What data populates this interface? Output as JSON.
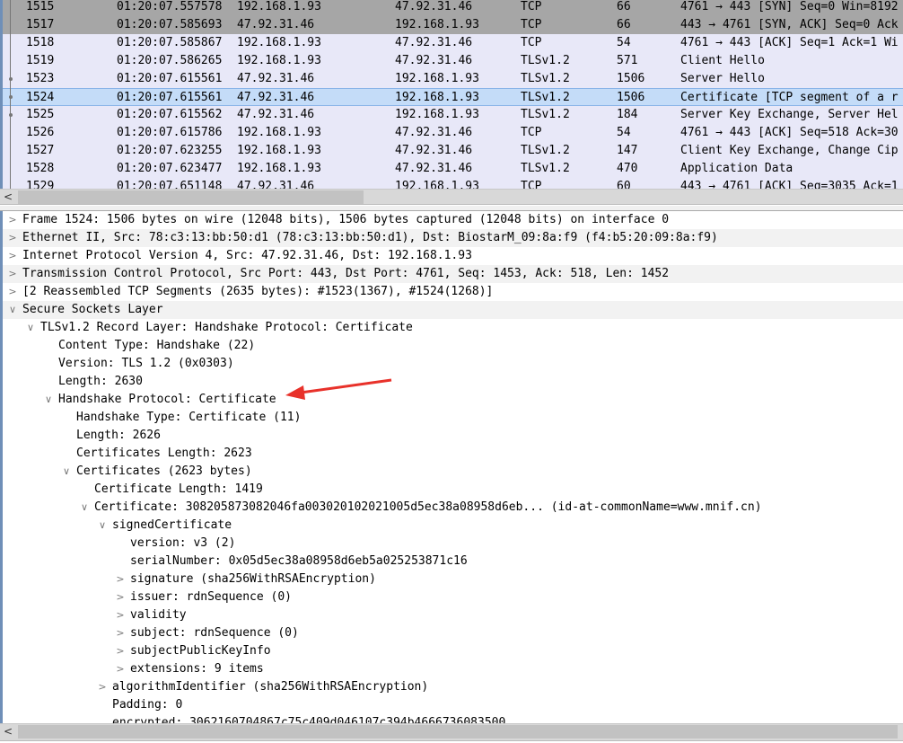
{
  "packet_list": {
    "rows": [
      {
        "no": "1515",
        "time": "01:20:07.557578",
        "src": "192.168.1.93",
        "dst": "47.92.31.46",
        "proto": "TCP",
        "len": "66",
        "info": "4761 → 443 [SYN] Seq=0 Win=8192",
        "style": "gray"
      },
      {
        "no": "1517",
        "time": "01:20:07.585693",
        "src": "47.92.31.46",
        "dst": "192.168.1.93",
        "proto": "TCP",
        "len": "66",
        "info": "443 → 4761 [SYN, ACK] Seq=0 Ack",
        "style": "gray"
      },
      {
        "no": "1518",
        "time": "01:20:07.585867",
        "src": "192.168.1.93",
        "dst": "47.92.31.46",
        "proto": "TCP",
        "len": "54",
        "info": "4761 → 443 [ACK] Seq=1 Ack=1 Wi",
        "style": ""
      },
      {
        "no": "1519",
        "time": "01:20:07.586265",
        "src": "192.168.1.93",
        "dst": "47.92.31.46",
        "proto": "TLSv1.2",
        "len": "571",
        "info": "Client Hello",
        "style": ""
      },
      {
        "no": "1523",
        "time": "01:20:07.615561",
        "src": "47.92.31.46",
        "dst": "192.168.1.93",
        "proto": "TLSv1.2",
        "len": "1506",
        "info": "Server Hello",
        "style": ""
      },
      {
        "no": "1524",
        "time": "01:20:07.615561",
        "src": "47.92.31.46",
        "dst": "192.168.1.93",
        "proto": "TLSv1.2",
        "len": "1506",
        "info": "Certificate [TCP segment of a r",
        "style": "sel"
      },
      {
        "no": "1525",
        "time": "01:20:07.615562",
        "src": "47.92.31.46",
        "dst": "192.168.1.93",
        "proto": "TLSv1.2",
        "len": "184",
        "info": "Server Key Exchange, Server Hel",
        "style": ""
      },
      {
        "no": "1526",
        "time": "01:20:07.615786",
        "src": "192.168.1.93",
        "dst": "47.92.31.46",
        "proto": "TCP",
        "len": "54",
        "info": "4761 → 443 [ACK] Seq=518 Ack=30",
        "style": ""
      },
      {
        "no": "1527",
        "time": "01:20:07.623255",
        "src": "192.168.1.93",
        "dst": "47.92.31.46",
        "proto": "TLSv1.2",
        "len": "147",
        "info": "Client Key Exchange, Change Cip",
        "style": ""
      },
      {
        "no": "1528",
        "time": "01:20:07.623477",
        "src": "192.168.1.93",
        "dst": "47.92.31.46",
        "proto": "TLSv1.2",
        "len": "470",
        "info": "Application Data",
        "style": ""
      },
      {
        "no": "1529",
        "time": "01:20:07.651148",
        "src": "47.92.31.46",
        "dst": "192.168.1.93",
        "proto": "TCP",
        "len": "60",
        "info": "443 → 4761 [ACK] Seq=3035 Ack=1",
        "style": ""
      }
    ],
    "scroll_left_glyph": "<"
  },
  "details": {
    "rows": [
      {
        "level": 0,
        "state": "collapsed",
        "text": "Frame 1524: 1506 bytes on wire (12048 bits), 1506 bytes captured (12048 bits) on interface 0"
      },
      {
        "level": 0,
        "state": "collapsed",
        "text": "Ethernet II, Src: 78:c3:13:bb:50:d1 (78:c3:13:bb:50:d1), Dst: BiostarM_09:8a:f9 (f4:b5:20:09:8a:f9)"
      },
      {
        "level": 0,
        "state": "collapsed",
        "text": "Internet Protocol Version 4, Src: 47.92.31.46, Dst: 192.168.1.93"
      },
      {
        "level": 0,
        "state": "collapsed",
        "text": "Transmission Control Protocol, Src Port: 443, Dst Port: 4761, Seq: 1453, Ack: 518, Len: 1452"
      },
      {
        "level": 0,
        "state": "collapsed",
        "text": "[2 Reassembled TCP Segments (2635 bytes): #1523(1367), #1524(1268)]"
      },
      {
        "level": 0,
        "state": "expanded",
        "text": "Secure Sockets Layer"
      },
      {
        "level": 1,
        "state": "expanded",
        "text": "TLSv1.2 Record Layer: Handshake Protocol: Certificate"
      },
      {
        "level": 2,
        "state": "leaf",
        "text": "Content Type: Handshake (22)"
      },
      {
        "level": 2,
        "state": "leaf",
        "text": "Version: TLS 1.2 (0x0303)"
      },
      {
        "level": 2,
        "state": "leaf",
        "text": "Length: 2630"
      },
      {
        "level": 2,
        "state": "expanded",
        "text": "Handshake Protocol: Certificate"
      },
      {
        "level": 3,
        "state": "leaf",
        "text": "Handshake Type: Certificate (11)"
      },
      {
        "level": 3,
        "state": "leaf",
        "text": "Length: 2626"
      },
      {
        "level": 3,
        "state": "leaf",
        "text": "Certificates Length: 2623"
      },
      {
        "level": 3,
        "state": "expanded",
        "text": "Certificates (2623 bytes)"
      },
      {
        "level": 4,
        "state": "leaf",
        "text": "Certificate Length: 1419"
      },
      {
        "level": 4,
        "state": "expanded",
        "text": "Certificate: 308205873082046fa003020102021005d5ec38a08958d6eb... (id-at-commonName=www.mnif.cn)"
      },
      {
        "level": 5,
        "state": "expanded",
        "text": "signedCertificate"
      },
      {
        "level": 6,
        "state": "leaf",
        "text": "version: v3 (2)"
      },
      {
        "level": 6,
        "state": "leaf",
        "text": "serialNumber: 0x05d5ec38a08958d6eb5a025253871c16"
      },
      {
        "level": 6,
        "state": "collapsed",
        "text": "signature (sha256WithRSAEncryption)"
      },
      {
        "level": 6,
        "state": "collapsed",
        "text": "issuer: rdnSequence (0)"
      },
      {
        "level": 6,
        "state": "collapsed",
        "text": "validity"
      },
      {
        "level": 6,
        "state": "collapsed",
        "text": "subject: rdnSequence (0)"
      },
      {
        "level": 6,
        "state": "collapsed",
        "text": "subjectPublicKeyInfo"
      },
      {
        "level": 6,
        "state": "collapsed",
        "text": "extensions: 9 items"
      },
      {
        "level": 5,
        "state": "collapsed",
        "text": "algorithmIdentifier (sha256WithRSAEncryption)"
      },
      {
        "level": 5,
        "state": "leaf",
        "text": "Padding: 0"
      },
      {
        "level": 5,
        "state": "leaf",
        "text": "encrypted: 3062160704867c75c409d046107c394b4666736083500"
      }
    ],
    "scroll_left_glyph": "<"
  },
  "icons": {
    "expanded": "⌄",
    "collapsed": "›"
  },
  "colors": {
    "selected_row": "#c4dcf8",
    "gray_row": "#a6a6a6",
    "list_bg": "#e8e8f8",
    "annotation_arrow": "#e8312a"
  }
}
